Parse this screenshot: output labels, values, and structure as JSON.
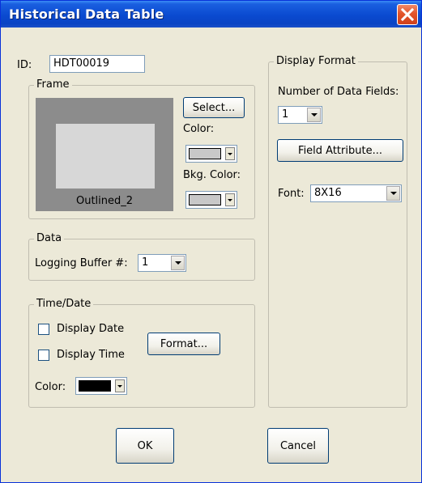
{
  "dialog": {
    "title": "Historical Data Table"
  },
  "id_field": {
    "label": "ID:",
    "value": "HDT00019"
  },
  "frame": {
    "group_label": "Frame",
    "preview_caption": "Outlined_2",
    "select_label": "Select...",
    "color_label": "Color:",
    "bkg_color_label": "Bkg. Color:",
    "color_value": "#c8c8c8",
    "bkg_color_value": "#c8c8c8"
  },
  "data_group": {
    "group_label": "Data",
    "buffer_label": "Logging Buffer #:",
    "buffer_value": "1"
  },
  "time_date": {
    "group_label": "Time/Date",
    "display_date_label": "Display Date",
    "display_time_label": "Display Time",
    "display_date_checked": false,
    "display_time_checked": false,
    "format_label": "Format...",
    "color_label": "Color:",
    "color_value": "#000000"
  },
  "display_format": {
    "group_label": "Display Format",
    "fields_label": "Number of Data Fields:",
    "fields_value": "1",
    "field_attribute_label": "Field Attribute...",
    "font_label": "Font:",
    "font_value": "8X16"
  },
  "footer": {
    "ok_label": "OK",
    "cancel_label": "Cancel"
  }
}
